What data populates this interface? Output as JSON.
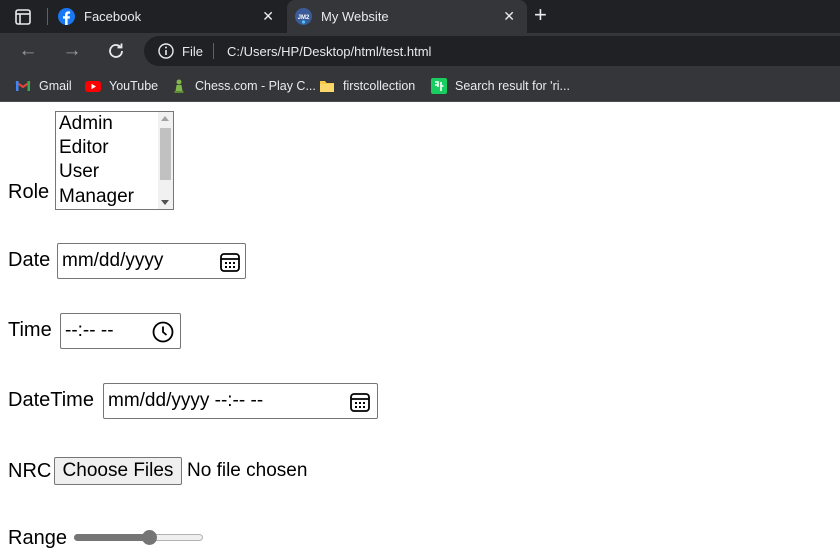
{
  "browser": {
    "tabs": [
      {
        "title": "Facebook",
        "active": false,
        "icon": "facebook-icon"
      },
      {
        "title": "My Website",
        "active": true,
        "icon": "site-icon"
      }
    ],
    "omnibox": {
      "scheme": "File",
      "url": "C:/Users/HP/Desktop/html/test.html"
    },
    "bookmarks": [
      {
        "label": "Gmail",
        "icon": "gmail-icon"
      },
      {
        "label": "YouTube",
        "icon": "youtube-icon"
      },
      {
        "label": "Chess.com - Play C...",
        "icon": "chess-icon"
      },
      {
        "label": "firstcollection",
        "icon": "folder-icon"
      },
      {
        "label": "Search result for 'ri...",
        "icon": "search-result-icon"
      }
    ],
    "colors": {
      "tabstrip": "#202124",
      "toolbar": "#35363a",
      "text": "#e8eaed"
    }
  },
  "form": {
    "role": {
      "label": "Role",
      "options": [
        "Admin",
        "Editor",
        "User",
        "Manager"
      ]
    },
    "date": {
      "label": "Date",
      "value": "mm/dd/yyyy"
    },
    "time": {
      "label": "Time",
      "value": "--:-- --"
    },
    "datetime": {
      "label": "DateTime",
      "value": "mm/dd/yyyy --:-- --"
    },
    "nrc": {
      "label": "NRC",
      "button": "Choose Files",
      "status": "No file chosen"
    },
    "range": {
      "label": "Range",
      "value": 0.6
    }
  }
}
